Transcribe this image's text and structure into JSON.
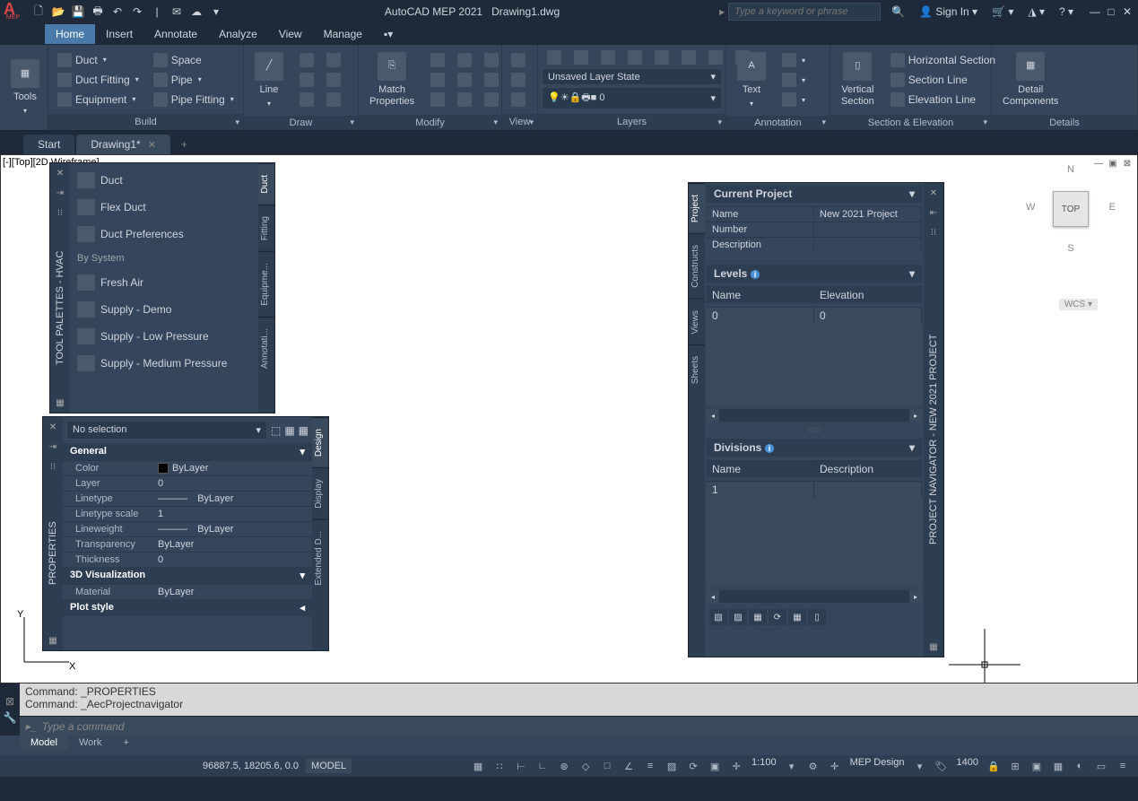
{
  "app": {
    "name": "AutoCAD MEP 2021",
    "file": "Drawing1.dwg",
    "logo": "A",
    "logo_sub": "MEP"
  },
  "titlebar": {
    "search_placeholder": "Type a keyword or phrase",
    "signin": "Sign In"
  },
  "menu": {
    "tabs": [
      "Home",
      "Insert",
      "Annotate",
      "Analyze",
      "View",
      "Manage"
    ],
    "active": "Home"
  },
  "ribbon": {
    "tools": "Tools",
    "build": {
      "title": "Build",
      "items": {
        "duct": "Duct",
        "duct_fitting": "Duct Fitting",
        "equipment": "Equipment",
        "space": "Space",
        "pipe": "Pipe",
        "pipe_fitting": "Pipe Fitting"
      }
    },
    "draw": {
      "title": "Draw",
      "line": "Line"
    },
    "modify": {
      "title": "Modify",
      "match": "Match\nProperties"
    },
    "view": {
      "title": "View"
    },
    "layers": {
      "title": "Layers",
      "state": "Unsaved Layer State",
      "current": "0"
    },
    "annotation": {
      "title": "Annotation",
      "text": "Text"
    },
    "section_elev": {
      "title": "Section & Elevation",
      "vsec": "Vertical\nSection",
      "hsec": "Horizontal Section",
      "sline": "Section Line",
      "eline": "Elevation Line"
    },
    "details": {
      "title": "Details",
      "comp": "Detail\nComponents"
    }
  },
  "doctabs": {
    "start": "Start",
    "drawing": "Drawing1*"
  },
  "viewport": {
    "label": "[-][Top][2D Wireframe]"
  },
  "tool_palettes": {
    "title": "TOOL PALETTES - HVAC",
    "tabs": [
      "Duct",
      "Fitting",
      "Equipme...",
      "Annotati..."
    ],
    "items": {
      "duct": "Duct",
      "flex": "Flex Duct",
      "prefs": "Duct Preferences"
    },
    "section": "By System",
    "sys_items": [
      "Fresh Air",
      "Supply - Demo",
      "Supply - Low Pressure",
      "Supply - Medium Pressure"
    ]
  },
  "properties": {
    "title": "PROPERTIES",
    "selection": "No selection",
    "tabs": [
      "Design",
      "Display",
      "Extended D..."
    ],
    "general": "General",
    "viz": "3D Visualization",
    "plot": "Plot style",
    "rows": {
      "color_k": "Color",
      "color_v": "ByLayer",
      "layer_k": "Layer",
      "layer_v": "0",
      "lt_k": "Linetype",
      "lt_v": "ByLayer",
      "lts_k": "Linetype scale",
      "lts_v": "1",
      "lw_k": "Lineweight",
      "lw_v": "ByLayer",
      "tr_k": "Transparency",
      "tr_v": "ByLayer",
      "th_k": "Thickness",
      "th_v": "0",
      "mat_k": "Material",
      "mat_v": "ByLayer"
    }
  },
  "project_nav": {
    "title": "PROJECT NAVIGATOR - NEW 2021 PROJECT",
    "tabs": [
      "Project",
      "Constructs",
      "Views",
      "Sheets"
    ],
    "current_project": {
      "head": "Current Project",
      "name_k": "Name",
      "name_v": "New 2021 Project",
      "num_k": "Number",
      "num_v": "",
      "desc_k": "Description",
      "desc_v": ""
    },
    "levels": {
      "head": "Levels",
      "c1": "Name",
      "c2": "Elevation",
      "r1c1": "0",
      "r1c2": "0"
    },
    "divisions": {
      "head": "Divisions",
      "c1": "Name",
      "c2": "Description",
      "r1c1": "1",
      "r1c2": ""
    }
  },
  "viewcube": {
    "n": "N",
    "s": "S",
    "e": "E",
    "w": "W",
    "face": "TOP",
    "wcs": "WCS"
  },
  "command": {
    "log1": "Command: _PROPERTIES",
    "log2": "Command: _AecProjectnavigator",
    "prompt": "Type a command"
  },
  "model_tabs": {
    "model": "Model",
    "work": "Work"
  },
  "statusbar": {
    "coords": "96887.5, 18205.6, 0.0",
    "model": "MODEL",
    "scale": "1:100",
    "anno": "1400",
    "ws": "MEP Design"
  }
}
